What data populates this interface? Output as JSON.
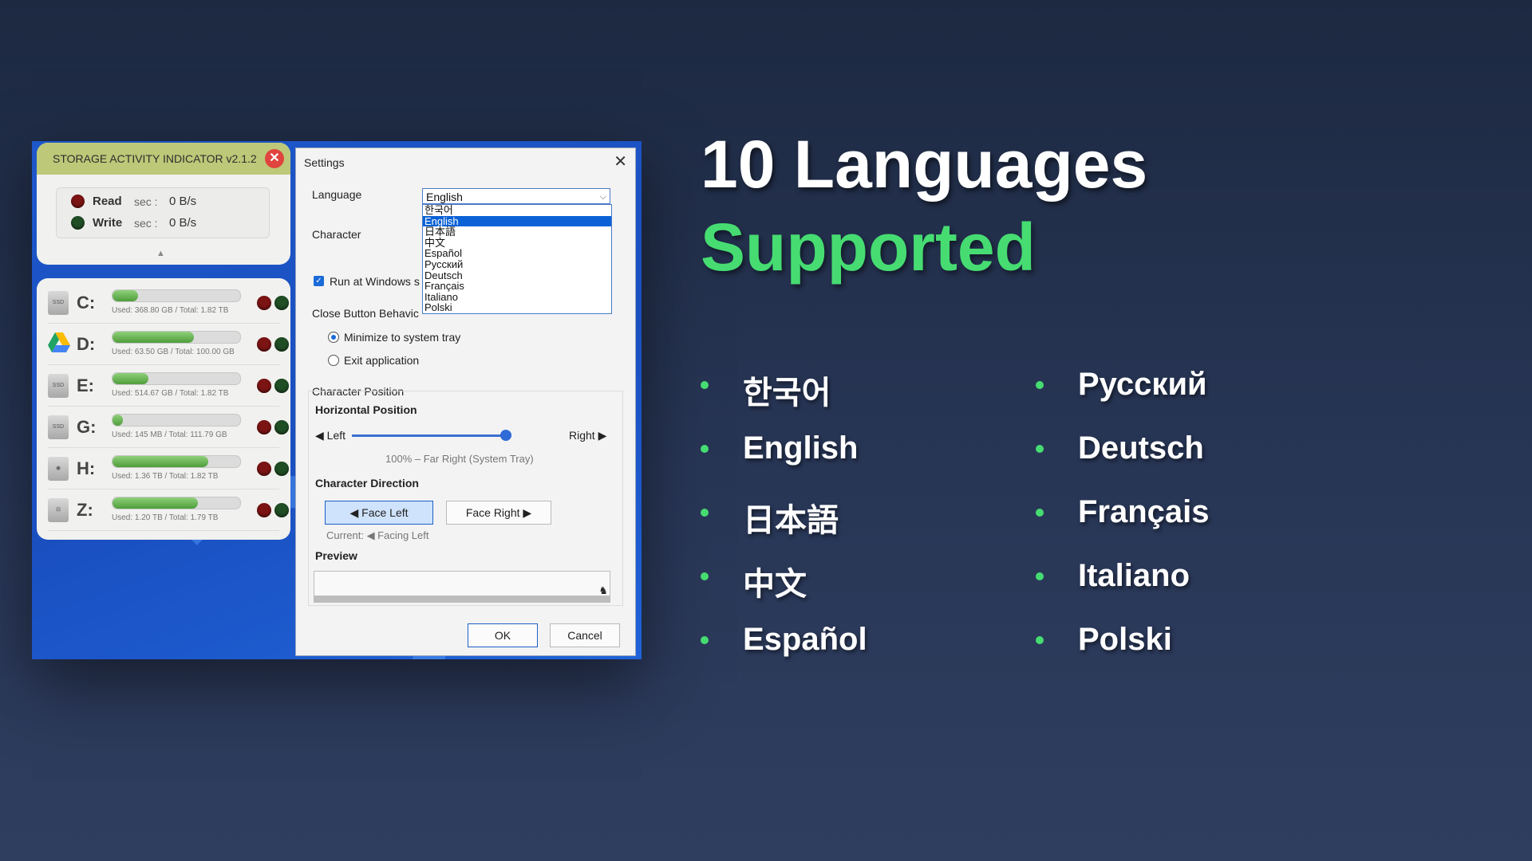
{
  "widget": {
    "title": "STORAGE ACTIVITY INDICATOR  v2.1.2",
    "read_label": "Read",
    "write_label": "Write",
    "sec_label": "sec :",
    "read_value": "0 B/s",
    "write_value": "0 B/s",
    "drives": [
      {
        "letter": "C:",
        "icon": "ssd-icon",
        "used_fraction": 0.2,
        "info": "Used: 368.80 GB / Total: 1.82 TB"
      },
      {
        "letter": "D:",
        "icon": "google-drive-icon",
        "used_fraction": 0.64,
        "info": "Used: 63.50 GB / Total: 100.00 GB"
      },
      {
        "letter": "E:",
        "icon": "ssd-icon",
        "used_fraction": 0.28,
        "info": "Used: 514.67 GB / Total: 1.82 TB"
      },
      {
        "letter": "G:",
        "icon": "ssd-icon",
        "used_fraction": 0.08,
        "info": "Used: 145 MB / Total: 111.79 GB"
      },
      {
        "letter": "H:",
        "icon": "hdd-icon",
        "used_fraction": 0.75,
        "info": "Used: 1.36 TB / Total: 1.82 TB"
      },
      {
        "letter": "Z:",
        "icon": "network-drive-icon",
        "used_fraction": 0.67,
        "info": "Used: 1.20 TB / Total: 1.79 TB"
      }
    ]
  },
  "settings": {
    "title": "Settings",
    "language_label": "Language",
    "language_value": "English",
    "language_options": [
      "한국어",
      "English",
      "日本語",
      "中文",
      "Español",
      "Русский",
      "Deutsch",
      "Français",
      "Italiano",
      "Polski"
    ],
    "character_label": "Character",
    "run_at_windows": "Run at Windows s",
    "close_behavior_label": "Close Button Behavic",
    "minimize_label": "Minimize to system tray",
    "exit_label": "Exit application",
    "char_position_label": "Character Position",
    "horizontal_label": "Horizontal Position",
    "left_label": "◀ Left",
    "right_label": "Right ▶",
    "position_hint": "100% – Far Right (System Tray)",
    "direction_label": "Character Direction",
    "face_left": "◀ Face Left",
    "face_right": "Face Right ▶",
    "current_label": "Current: ◀ Facing Left",
    "preview_label": "Preview",
    "ok": "OK",
    "cancel": "Cancel"
  },
  "headline": {
    "line1": "10 Languages",
    "line2": "Supported"
  },
  "languages_left": [
    "한국어",
    "English",
    "日本語",
    "中文",
    "Español"
  ],
  "languages_right": [
    "Русский",
    "Deutsch",
    "Français",
    "Italiano",
    "Polski"
  ],
  "colors": {
    "accent_green": "#46dc72",
    "background": "#283656"
  }
}
